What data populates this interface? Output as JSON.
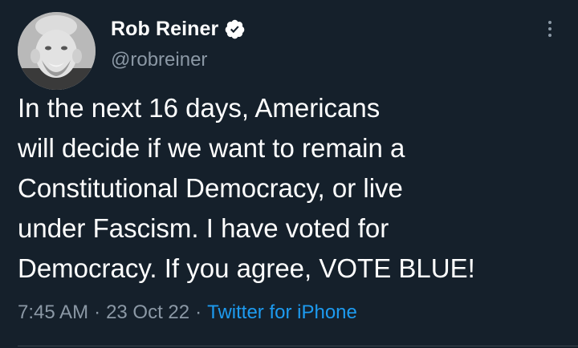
{
  "author": {
    "display_name": "Rob Reiner",
    "handle": "@robreiner",
    "verified": true,
    "avatar_icon": "profile-photo"
  },
  "tweet": {
    "text_lines": [
      "In the next 16 days, Americans",
      "will decide if we want to remain a",
      "Constitutional Democracy, or live",
      "under Fascism. I have voted for",
      "Democracy. If you agree, VOTE BLUE!"
    ],
    "time": "7:45 AM",
    "date": "23 Oct 22",
    "separator": "·",
    "source": "Twitter for iPhone"
  },
  "icons": {
    "verified": "verified-badge-icon",
    "more": "more-options-icon"
  },
  "colors": {
    "background": "#15202b",
    "text": "#ffffff",
    "secondary_text": "#8b98a5",
    "link": "#1d9bf0",
    "divider": "#38444d"
  }
}
